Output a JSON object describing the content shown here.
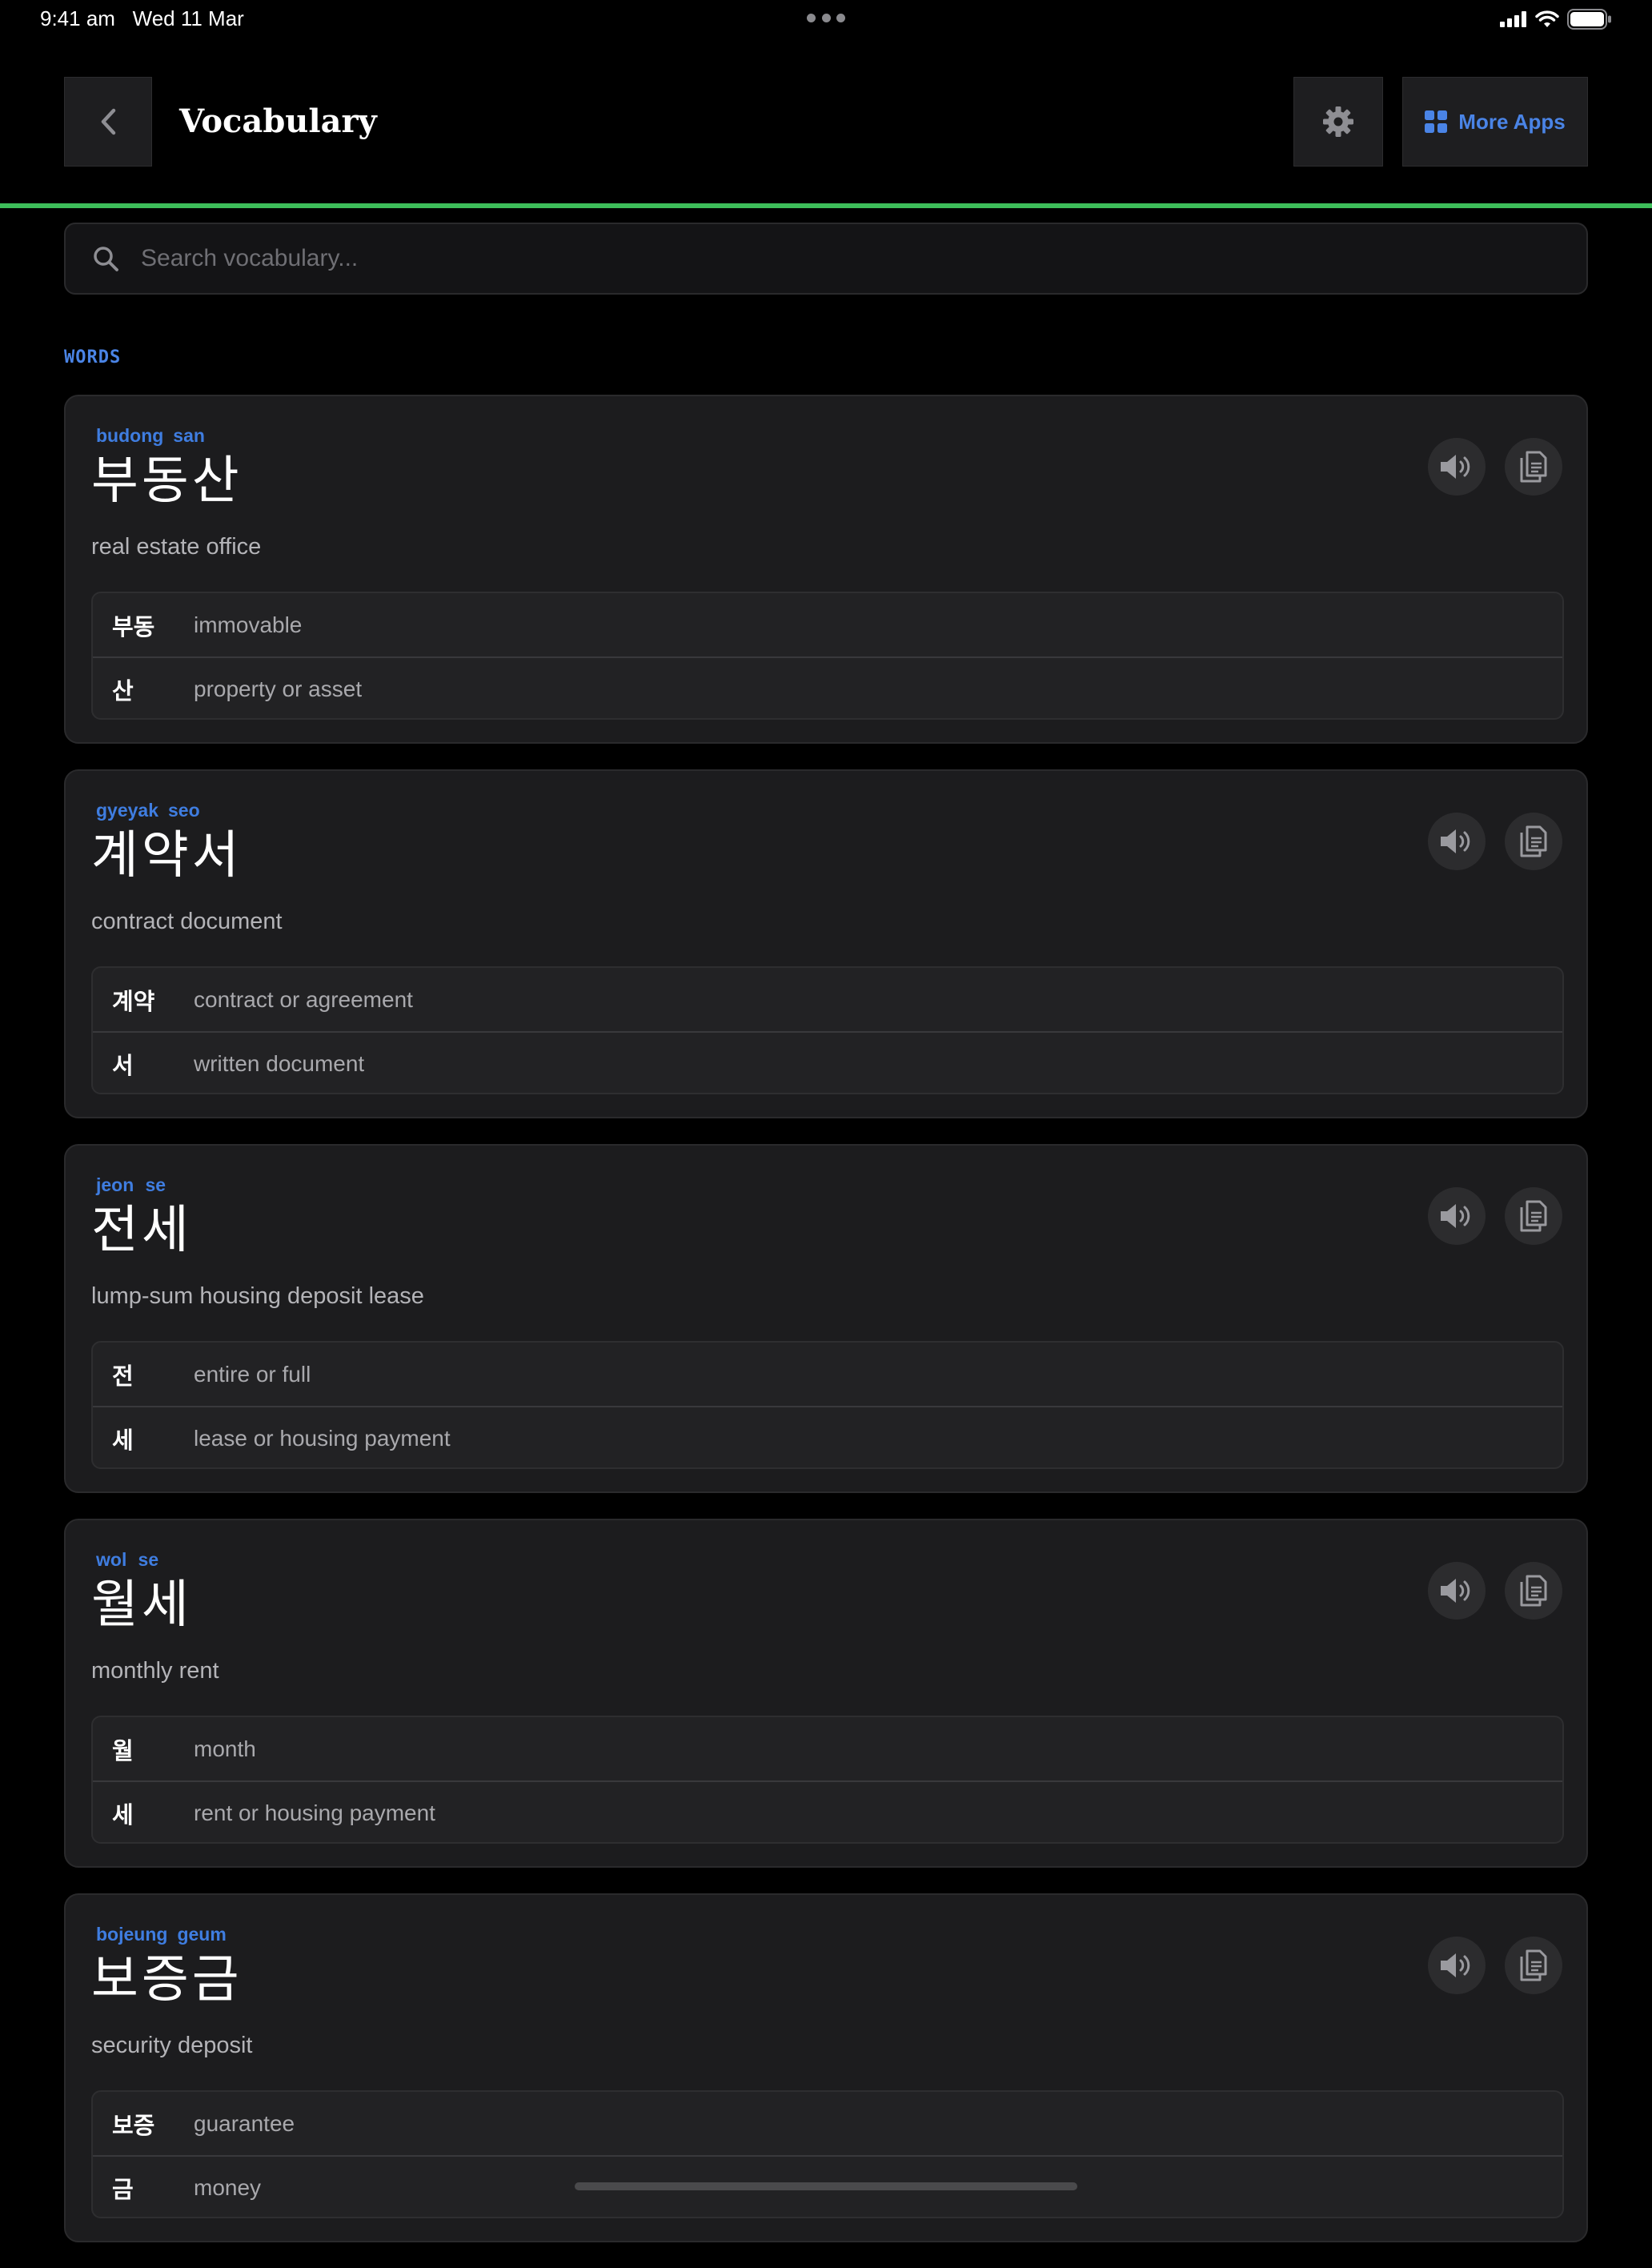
{
  "status_bar": {
    "time": "9:41 am",
    "date": "Wed 11 Mar"
  },
  "header": {
    "title": "Vocabulary",
    "more_apps_label": "More Apps",
    "back_icon": "chevron-left-icon",
    "settings_icon": "gear-icon",
    "apps_icon": "grid-icon",
    "progress": 1.0
  },
  "search": {
    "placeholder": "Search vocabulary...",
    "value": ""
  },
  "section_label": "WORDS",
  "colors": {
    "accent": "#4a84e6",
    "progress": "#3dbe5a",
    "card": "#1c1c1e"
  },
  "words": [
    {
      "romanization": [
        "budong",
        "san"
      ],
      "korean": "부동산",
      "meaning": "real estate office",
      "parts": [
        {
          "syllable": "부동",
          "meaning": "immovable"
        },
        {
          "syllable": "산",
          "meaning": "property or asset"
        }
      ]
    },
    {
      "romanization": [
        "gyeyak",
        "seo"
      ],
      "korean": "계약서",
      "meaning": "contract document",
      "parts": [
        {
          "syllable": "계약",
          "meaning": "contract or agreement"
        },
        {
          "syllable": "서",
          "meaning": "written document"
        }
      ]
    },
    {
      "romanization": [
        "jeon",
        "se"
      ],
      "korean": "전세",
      "meaning": "lump-sum housing deposit lease",
      "parts": [
        {
          "syllable": "전",
          "meaning": "entire or full"
        },
        {
          "syllable": "세",
          "meaning": "lease or housing payment"
        }
      ]
    },
    {
      "romanization": [
        "wol",
        "se"
      ],
      "korean": "월세",
      "meaning": "monthly rent",
      "parts": [
        {
          "syllable": "월",
          "meaning": "month"
        },
        {
          "syllable": "세",
          "meaning": "rent or housing payment"
        }
      ]
    },
    {
      "romanization": [
        "bojeung",
        "geum"
      ],
      "korean": "보증금",
      "meaning": "security deposit",
      "parts": [
        {
          "syllable": "보증",
          "meaning": "guarantee"
        },
        {
          "syllable": "금",
          "meaning": "money"
        }
      ]
    }
  ]
}
